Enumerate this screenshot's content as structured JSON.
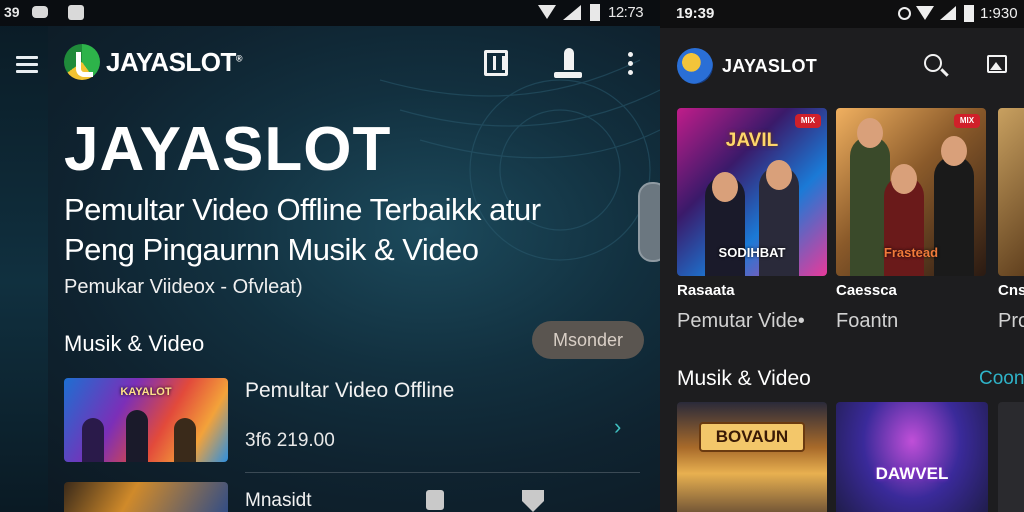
{
  "left_phone": {
    "status_bar": {
      "left_time": "39",
      "clock": "12:73"
    },
    "toolbar": {
      "app_name": "JAYASLOT",
      "trademark": "®"
    },
    "hero": {
      "title": "JAYASLOT",
      "subtitle_line1": "Pemultar Video Offline Terbaikk atur",
      "subtitle_line2": "Peng Pingaurnn Musik & Video",
      "subtitle_small": "Pemukar Viideox - Ofvleat)"
    },
    "section": {
      "title": "Musik & Video",
      "pill_label": "Msonder"
    },
    "rows": [
      {
        "thumb_title": "KAYALOT",
        "title": "Pemultar Video Offline",
        "price": "3f6 219.00"
      },
      {
        "title": "Mnasidt"
      }
    ]
  },
  "right_phone": {
    "status_bar": {
      "time": "19:39",
      "clock": "1:930"
    },
    "toolbar": {
      "app_name": "JAYASLOT"
    },
    "top_cards": [
      {
        "badge": "MIX",
        "title": "JAVIL",
        "bottom": "SODIHBAT",
        "caption": "Rasaata",
        "caption_sub": "Pemutar Vide•"
      },
      {
        "badge": "MIX",
        "title": "",
        "bottom": "Frastead",
        "caption": "Caessca",
        "caption_sub": "Foantn"
      },
      {
        "caption": "Cns",
        "caption_sub": "Pro"
      }
    ],
    "section": {
      "title": "Musik & Video",
      "link": "Coon"
    },
    "bottom_cards": [
      {
        "label": "BOVAUN"
      },
      {
        "label": "DAWVEL"
      }
    ]
  },
  "colors": {
    "accent_teal": "#3fbfc0",
    "link_teal": "#2fb3c8",
    "pill_bg": "#5a5550",
    "dark_bg": "#1d1d1f"
  },
  "icons": [
    "menu-icon",
    "logo-icon",
    "cast-icon",
    "download-icon",
    "more-vert-icon",
    "chevron-right-icon",
    "search-icon",
    "image-icon",
    "wifi-icon",
    "signal-icon",
    "battery-icon",
    "alarm-icon"
  ]
}
